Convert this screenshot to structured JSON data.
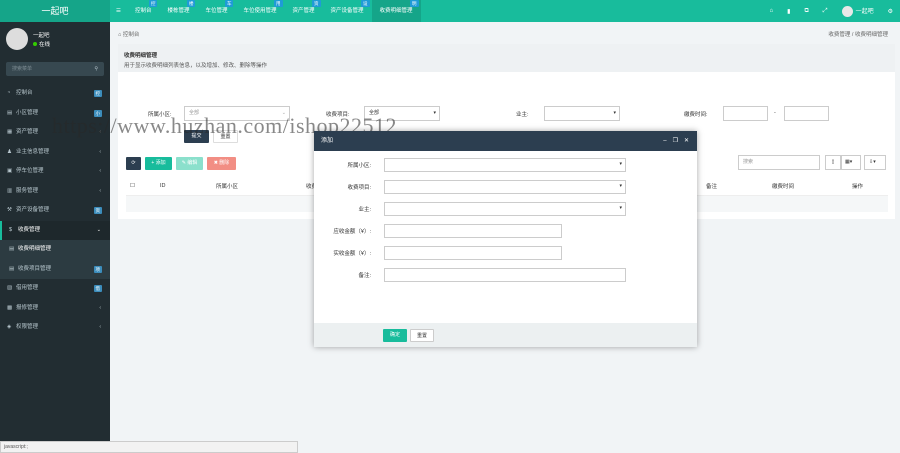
{
  "app": {
    "logo": "一起吧"
  },
  "topnav": {
    "items": [
      {
        "label": "控制台",
        "tag": "控"
      },
      {
        "label": "楼栋管理",
        "tag": "楼"
      },
      {
        "label": "车位管理",
        "tag": "车"
      },
      {
        "label": "车位使用管理",
        "tag": "用"
      },
      {
        "label": "资产管理",
        "tag": "资"
      },
      {
        "label": "资产设备管理",
        "tag": "设"
      },
      {
        "label": "收费明细管理",
        "tag": "明"
      }
    ],
    "user": "一起吧"
  },
  "sidebar": {
    "user_name": "一起吧",
    "status": "在线",
    "search_placeholder": "搜索菜单",
    "items": [
      {
        "label": "控制台",
        "icon": "dashboard-icon",
        "badge": "控"
      },
      {
        "label": "小区管理",
        "icon": "building-icon",
        "badge": "小"
      },
      {
        "label": "资产管理",
        "icon": "asset-icon",
        "badge": ""
      },
      {
        "label": "业主信息管理",
        "icon": "user-icon",
        "badge": ""
      },
      {
        "label": "停车位管理",
        "icon": "parking-icon",
        "badge": ""
      },
      {
        "label": "服务管理",
        "icon": "service-icon",
        "badge": ""
      },
      {
        "label": "资产设备管理",
        "icon": "device-icon",
        "badge": "资"
      },
      {
        "label": "收费管理",
        "icon": "dollar-icon",
        "badge": ""
      },
      {
        "label": "收费明细管理",
        "icon": "list-icon",
        "badge": ""
      },
      {
        "label": "收费项目管理",
        "icon": "list-icon",
        "badge": "项"
      },
      {
        "label": "借用管理",
        "icon": "borrow-icon",
        "badge": "借"
      },
      {
        "label": "报修管理",
        "icon": "wrench-icon",
        "badge": ""
      },
      {
        "label": "权限管理",
        "icon": "lock-icon",
        "badge": ""
      }
    ]
  },
  "breadcrumb": {
    "home": "控制台",
    "parent": "收费管理",
    "current": "收费明细管理"
  },
  "panel": {
    "title": "收费明细管理",
    "desc": "用于显示收费明细列表信息，以及增加、修改、删除等操作"
  },
  "filters": {
    "community_label": "所属小区:",
    "community_value": "全部",
    "item_label": "收费项目:",
    "item_value": "全部",
    "owner_label": "业主:",
    "time_label": "缴费时间:",
    "time_sep": "-",
    "submit": "提交",
    "reset": "重置"
  },
  "toolbar": {
    "add": "+ 添加",
    "edit": "✎ 编辑",
    "delete": "✖ 删除",
    "search_placeholder": "搜索"
  },
  "table": {
    "headers": [
      "ID",
      "所属小区",
      "收费",
      "备注",
      "缴费时间",
      "操作"
    ]
  },
  "modal": {
    "title": "添加",
    "fields": [
      {
        "label": "所属小区:"
      },
      {
        "label": "收费项目:"
      },
      {
        "label": "业主:"
      },
      {
        "label": "应收金额（¥）:"
      },
      {
        "label": "实收金额（¥）:"
      },
      {
        "label": "备注:"
      }
    ],
    "confirm": "确定",
    "reset": "重置"
  },
  "statusbar": {
    "text": "javascript:;"
  },
  "watermark": "https://www.huzhan.com/ishop22512",
  "colors": {
    "accent": "#18bc9c",
    "dark": "#222d32",
    "modal_head": "#2c3e50"
  }
}
